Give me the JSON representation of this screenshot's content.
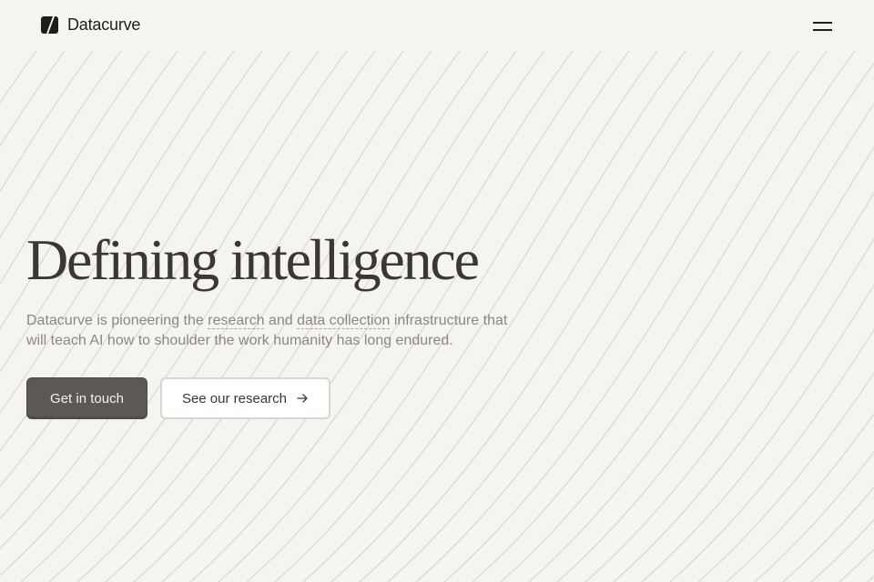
{
  "brand": {
    "name": "Datacurve",
    "logo_icon": "datacurve-logo-icon"
  },
  "nav": {
    "menu_icon": "hamburger-menu-icon"
  },
  "hero": {
    "title": "Defining intelligence",
    "description": {
      "part1": "Datacurve is pioneering the ",
      "link_research": "research",
      "part2": " and ",
      "link_data": "data collection",
      "part3": " infrastructure that will teach AI how to shoulder the work humanity has long endured."
    },
    "primary_button": "Get in touch",
    "secondary_button": "See our research",
    "secondary_icon": "arrow-right-icon"
  },
  "colors": {
    "background": "#f6f4ef",
    "primary_button": "#5e5854",
    "text_dark": "#3a3734",
    "text_muted": "#8b8782"
  }
}
